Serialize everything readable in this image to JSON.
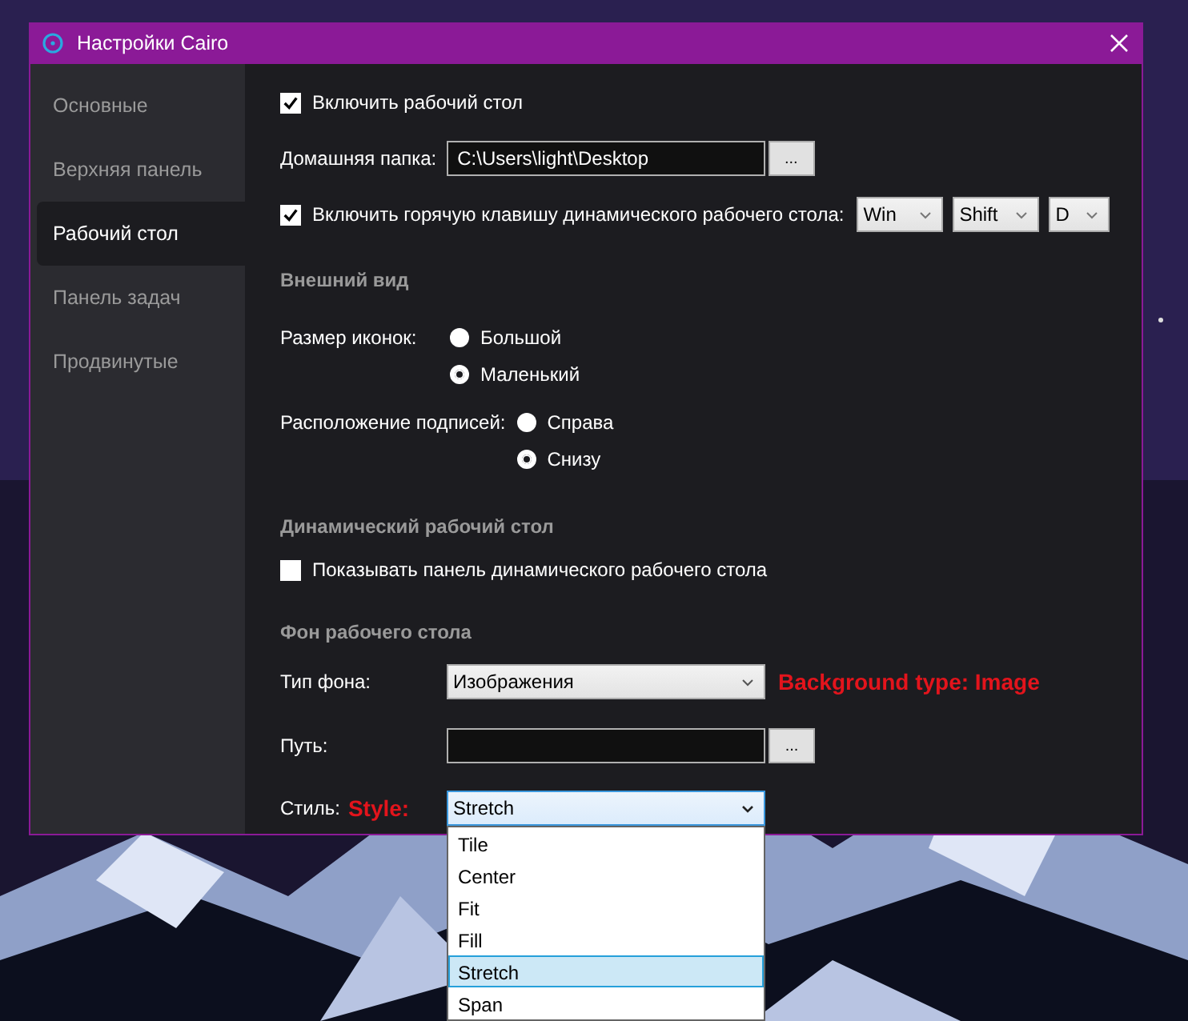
{
  "window": {
    "title": "Настройки Cairo"
  },
  "sidebar": {
    "items": [
      {
        "label": "Основные",
        "selected": false
      },
      {
        "label": "Верхняя панель",
        "selected": false
      },
      {
        "label": "Рабочий стол",
        "selected": true
      },
      {
        "label": "Панель задач",
        "selected": false
      },
      {
        "label": "Продвинутые",
        "selected": false
      }
    ]
  },
  "desktop": {
    "enable_desktop": {
      "label": "Включить рабочий стол",
      "checked": true
    },
    "home_folder": {
      "label": "Домашняя папка:",
      "value": "C:\\Users\\light\\Desktop",
      "browse": "..."
    },
    "hotkey": {
      "label": "Включить горячую клавишу динамического рабочего стола:",
      "checked": true,
      "keys": [
        "Win",
        "Shift",
        "D"
      ]
    },
    "appearance": {
      "heading": "Внешний вид",
      "icon_size": {
        "label": "Размер иконок:",
        "options": [
          {
            "label": "Большой",
            "selected": false
          },
          {
            "label": "Маленький",
            "selected": true
          }
        ]
      },
      "label_position": {
        "label": "Расположение подписей:",
        "options": [
          {
            "label": "Справа",
            "selected": false
          },
          {
            "label": "Снизу",
            "selected": true
          }
        ]
      }
    },
    "dynamic": {
      "heading": "Динамический рабочий стол",
      "show_panel": {
        "label": "Показывать панель динамического рабочего стола",
        "checked": false
      }
    },
    "background": {
      "heading": "Фон рабочего стола",
      "type": {
        "label": "Тип фона:",
        "value": "Изображения",
        "annotation": "Background type: Image"
      },
      "path": {
        "label": "Путь:",
        "browse": "..."
      },
      "style": {
        "label": "Стиль:",
        "annotation": "Style:",
        "value": "Stretch",
        "expanded": true,
        "options": [
          {
            "label": "Tile",
            "selected": false
          },
          {
            "label": "Center",
            "selected": false
          },
          {
            "label": "Fit",
            "selected": false
          },
          {
            "label": "Fill",
            "selected": false
          },
          {
            "label": "Stretch",
            "selected": true
          },
          {
            "label": "Span",
            "selected": false
          }
        ]
      }
    }
  }
}
